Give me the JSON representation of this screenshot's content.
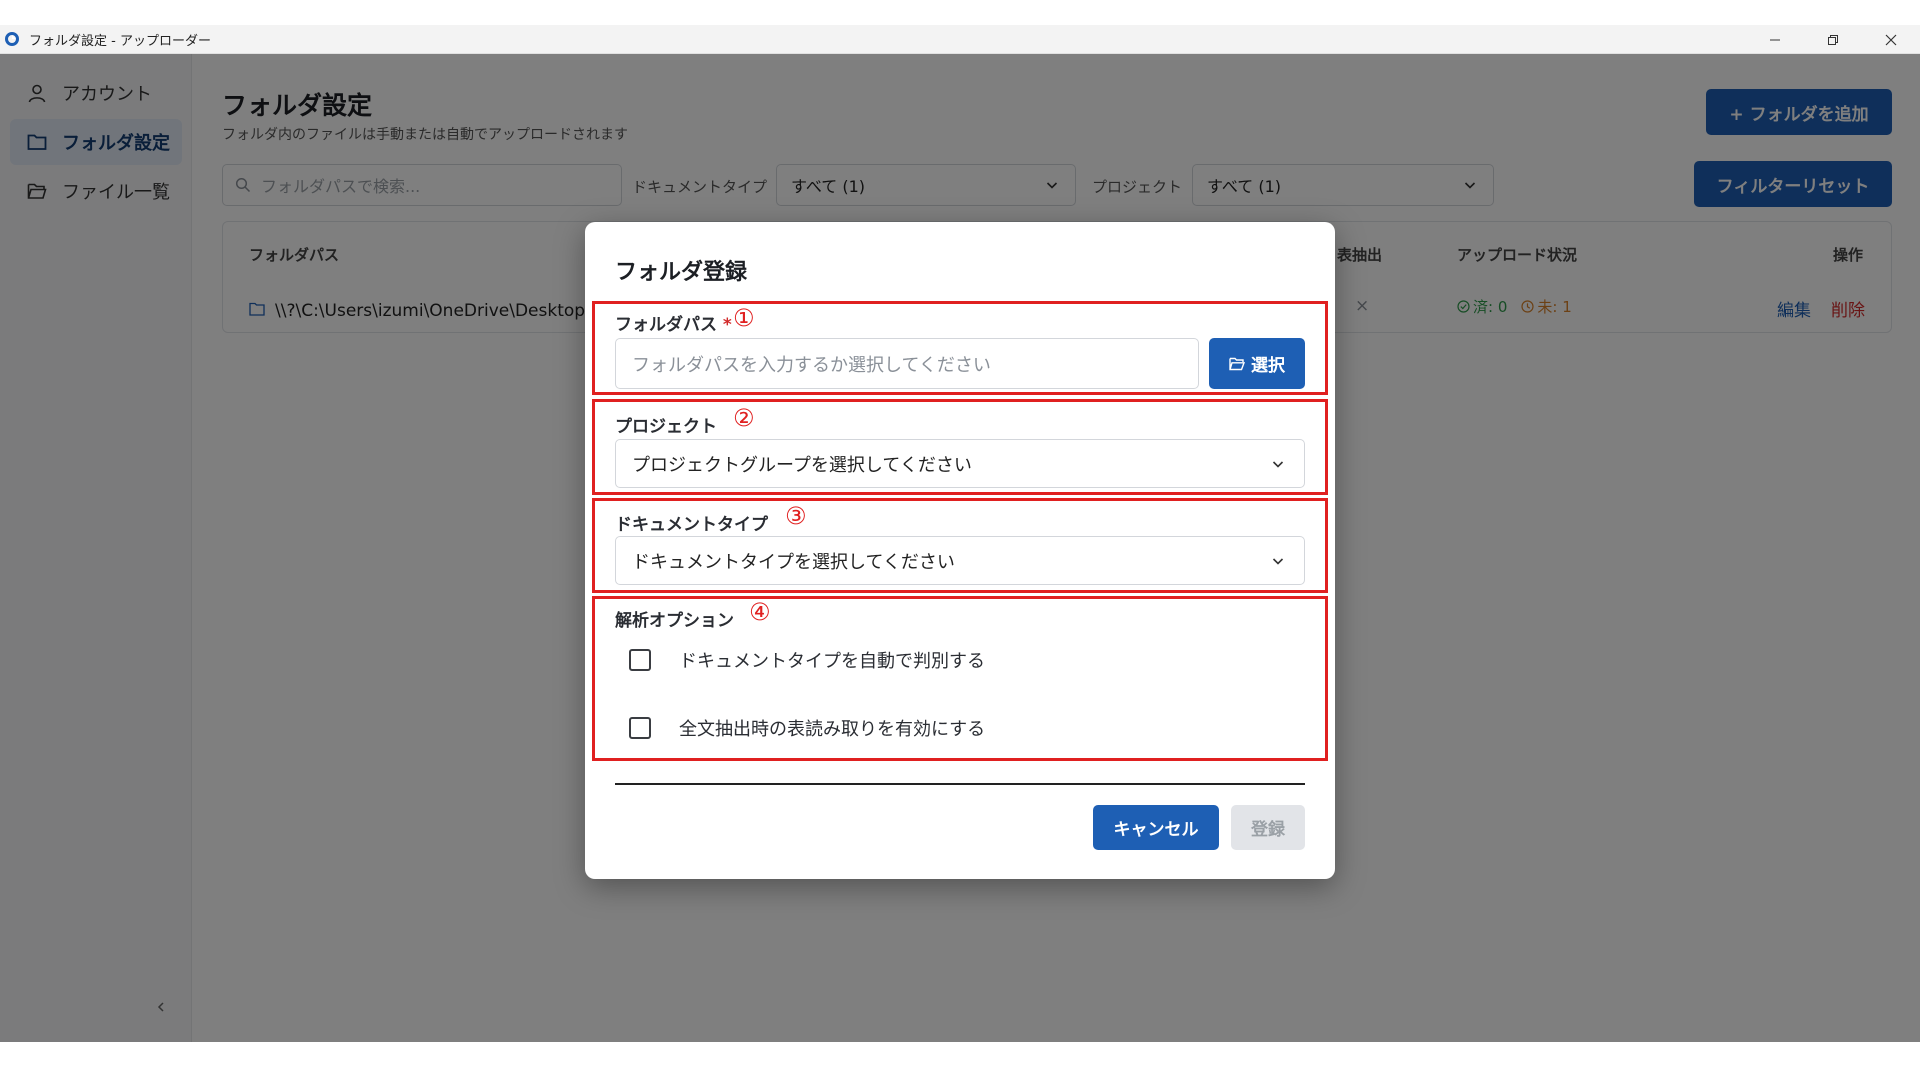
{
  "window": {
    "title": "フォルダ設定 - アップローダー",
    "icons": [
      "app-logo-icon",
      "minimize-icon",
      "restore-icon",
      "close-icon"
    ]
  },
  "sidebar": {
    "items": [
      {
        "label": "アカウント",
        "icon": "user-icon",
        "active": false
      },
      {
        "label": "フォルダ設定",
        "icon": "folder-icon",
        "active": true
      },
      {
        "label": "ファイル一覧",
        "icon": "folder-open-icon",
        "active": false
      }
    ],
    "collapse_icon": "chevron-left-icon"
  },
  "page": {
    "title": "フォルダ設定",
    "subtitle": "フォルダ内のファイルは手動または自動でアップロードされます",
    "add_button": "+ フォルダを追加",
    "reset_button": "フィルターリセット"
  },
  "filters": {
    "search_placeholder": "フォルダパスで検索...",
    "doctype_label": "ドキュメントタイプ",
    "doctype_value": "すべて (1)",
    "project_label": "プロジェクト",
    "project_value": "すべて (1)"
  },
  "table": {
    "headers": {
      "path": "フォルダパス",
      "table_extract": "表抽出",
      "upload_status": "アップロード状況",
      "actions": "操作"
    },
    "rows": [
      {
        "path": "\\\\?\\C:\\Users\\izumi\\OneDrive\\Desktop\\テ",
        "table_extract": "×",
        "done": "済: 0",
        "pending": "未: 1",
        "edit": "編集",
        "delete": "削除"
      }
    ]
  },
  "modal": {
    "title": "フォルダ登録",
    "folder_path_label": "フォルダパス",
    "required_mark": "*",
    "folder_path_placeholder": "フォルダパスを入力するか選択してください",
    "select_button": "選択",
    "project_label": "プロジェクト",
    "project_placeholder": "プロジェクトグループを選択してください",
    "doctype_label": "ドキュメントタイプ",
    "doctype_placeholder": "ドキュメントタイプを選択してください",
    "options_label": "解析オプション",
    "option_auto_detect": "ドキュメントタイプを自動で判別する",
    "option_table_read": "全文抽出時の表読み取りを有効にする",
    "cancel_button": "キャンセル",
    "submit_button": "登録"
  },
  "annotations": {
    "n1": "①",
    "n2": "②",
    "n3": "③",
    "n4": "④",
    "color": "#e02020"
  },
  "colors": {
    "accent": "#1e5fb4",
    "danger": "#d22b2b",
    "success": "#2e9b4a",
    "warning": "#d9822b"
  }
}
